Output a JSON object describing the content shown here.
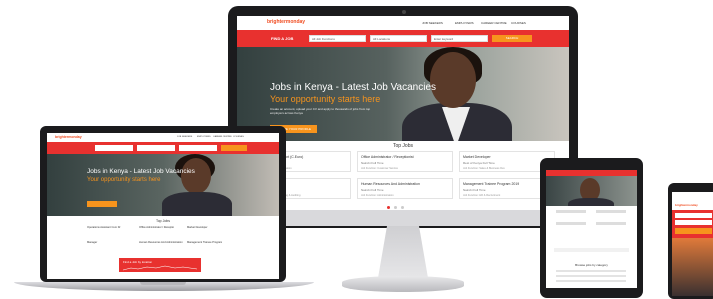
{
  "site": {
    "logo_text": "brightermonday",
    "nav": [
      "JOB SEEKERS",
      "EMPLOYERS",
      "CAREER CENTRE",
      "COURSES"
    ],
    "search_bar_label": "FIND A JOB",
    "field_1": "All Job Functions",
    "field_2": "All Locations",
    "field_3": "Enter keyword",
    "search_button": "SEARCH"
  },
  "hero": {
    "title": "Jobs in Kenya - Latest Job Vacancies",
    "subtitle": "Your opportunity starts here",
    "description": "Create an account, upload your CV and apply to thousands of jobs from top employers across Kenya",
    "button": "CREATE YOUR PROFILE"
  },
  "top_jobs": {
    "title": "Top Jobs",
    "cards": [
      {
        "title": "Executive Assistant (C.Euro)",
        "meta": "Nairobi  Full Time",
        "footer": "Job Function: Administration"
      },
      {
        "title": "Office Administrator / Receptionist",
        "meta": "Nairobi  Full Time",
        "footer": "Job Function: Customer Service"
      },
      {
        "title": "Market Developer",
        "meta": "Rest of Kenya  Full Time",
        "footer": "Job Function: Sales & Business Dev"
      },
      {
        "title": "Manager",
        "meta": "Nairobi  Full Time",
        "footer": "Job Function: Accounting & Auditing"
      },
      {
        "title": "Human Resources And Administration",
        "meta": "Nairobi  Full Time",
        "footer": "Job Function: Administration"
      },
      {
        "title": "Management Trainee Program 2019",
        "meta": "Nairobi  Full Time",
        "footer": "Job Function: HR & Recruitment"
      }
    ]
  },
  "laptop": {
    "banner": "Find a Job by location",
    "cards": [
      {
        "title": "Operations Assistant Cum Dr"
      },
      {
        "title": "Office Administrator / Receptio"
      },
      {
        "title": "Market Developer"
      },
      {
        "title": "Manager"
      },
      {
        "title": "Human Resources And Administration"
      },
      {
        "title": "Management Trainee Program"
      }
    ]
  },
  "tablet": {
    "section_title": "Browse jobs by category"
  }
}
